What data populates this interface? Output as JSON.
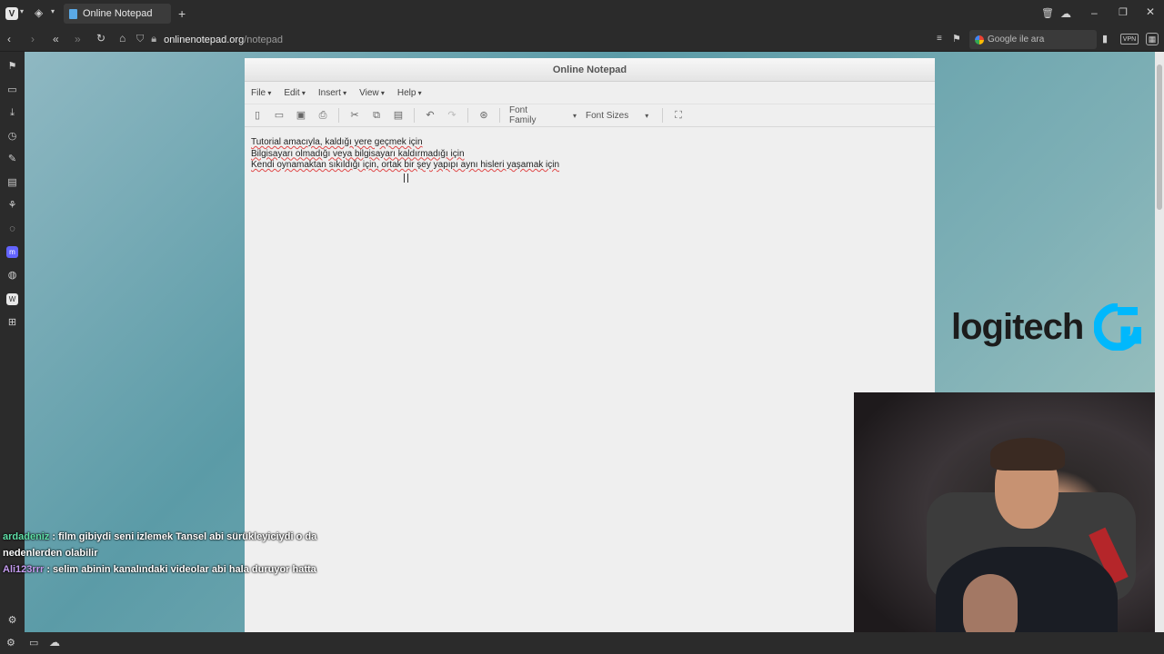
{
  "browser": {
    "tab_title": "Online Notepad",
    "url_domain": "onlinenotepad.org",
    "url_path": "/notepad",
    "search_placeholder": "Google ile ara",
    "vpn_label": "VPN"
  },
  "notepad": {
    "title": "Online Notepad",
    "menu": [
      "File",
      "Edit",
      "Insert",
      "View",
      "Help"
    ],
    "font_family_label": "Font Family",
    "font_sizes_label": "Font Sizes",
    "lines": [
      "Tutorial amacıyla, kaldığı yere geçmek için",
      "Bilgisayarı olmadığı veya bilgisayarı kaldırmadığı için",
      "Kendi oynamaktan sıkıldığı için, ortak bir şey yapıpı aynı hisleri yaşamak için"
    ]
  },
  "overlay": {
    "logo_text": "logitech",
    "chat": [
      {
        "user": "ardadeniz",
        "message": " : film gibiydi seni izlemek Tansel abi sürükleyiciydi o da nedenlerden olabilir"
      },
      {
        "user": "Ali123rrr",
        "message": " : selim abinin kanalındaki videolar abi hala duruyor hatta"
      }
    ]
  },
  "colors": {
    "accent_brand": "#00b8fc",
    "chat_user1": "#5fe0a8",
    "chat_user2": "#c59cf0"
  }
}
